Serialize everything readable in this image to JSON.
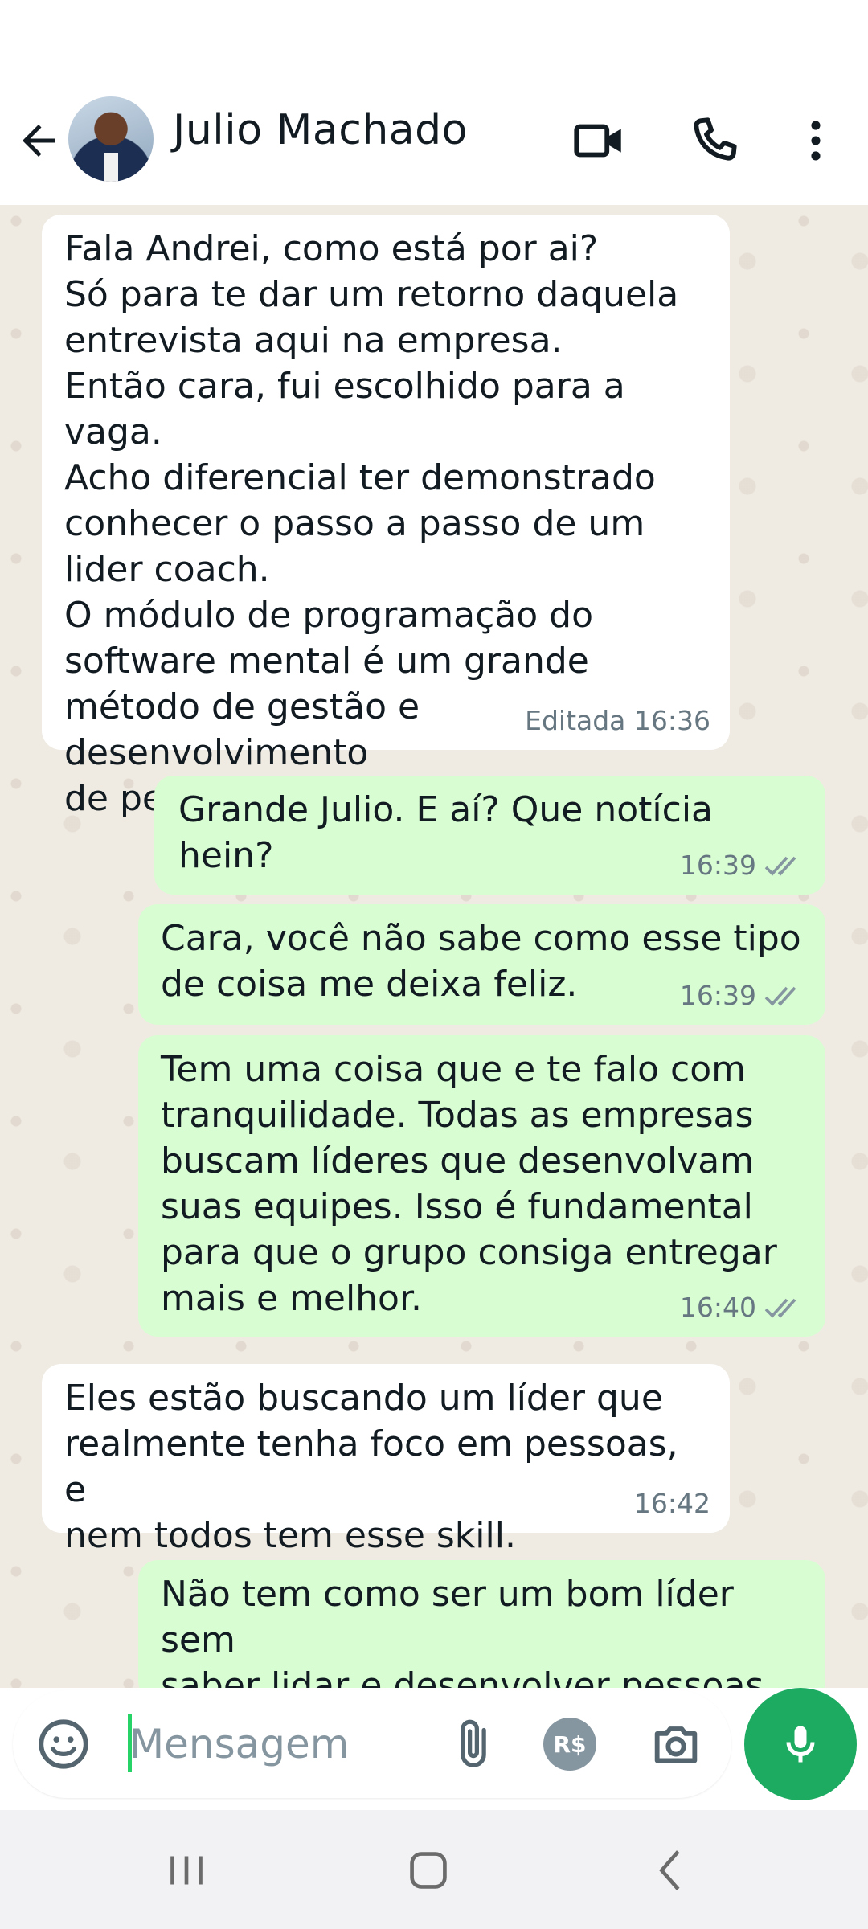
{
  "header": {
    "contact_name": "Julio Machado",
    "icons": [
      "back-arrow-icon",
      "video-call-icon",
      "voice-call-icon",
      "more-options-icon"
    ]
  },
  "messages": [
    {
      "direction": "incoming",
      "text": "Fala Andrei, como está por ai?\nSó para te dar um retorno daquela\nentrevista aqui na empresa.\nEntão cara, fui escolhido para a vaga.\nAcho diferencial ter demonstrado\nconhecer o passo a passo de um\nlider coach.\nO módulo de programação do\nsoftware mental é um grande\nmétodo de gestão e desenvolvimento\nde pessoas.",
      "meta": "Editada 16:36"
    },
    {
      "direction": "outgoing",
      "text": "Grande Julio. E aí? Que notícia hein?",
      "meta": "16:39",
      "status": "read"
    },
    {
      "direction": "outgoing",
      "text": "Cara, você não sabe como esse tipo\nde coisa me deixa feliz.",
      "meta": "16:39",
      "status": "read"
    },
    {
      "direction": "outgoing",
      "text": "Tem uma coisa que e te falo com\ntranquilidade. Todas as empresas\nbuscam líderes que desenvolvam\nsuas equipes. Isso é fundamental\npara que o grupo consiga entregar\nmais e melhor.",
      "meta": "16:40",
      "status": "read"
    },
    {
      "direction": "incoming",
      "text": "Eles estão buscando um líder que\nrealmente tenha foco em pessoas, e\nnem todos tem esse skill.",
      "meta": "16:42"
    },
    {
      "direction": "outgoing",
      "text": "Não tem como ser um bom líder sem\nsaber lidar e desenvolver pessoas",
      "meta": ""
    }
  ],
  "composer": {
    "placeholder": "Mensagem",
    "payment_label": "R$",
    "icons": [
      "emoji-icon",
      "attach-icon",
      "payment-icon",
      "camera-icon",
      "mic-icon"
    ]
  },
  "colors": {
    "incoming_bubble": "#ffffff",
    "outgoing_bubble": "#d9fdd3",
    "chat_background": "#efeae2",
    "read_ticks": "#8696a0",
    "mic_button": "#1daa61"
  }
}
